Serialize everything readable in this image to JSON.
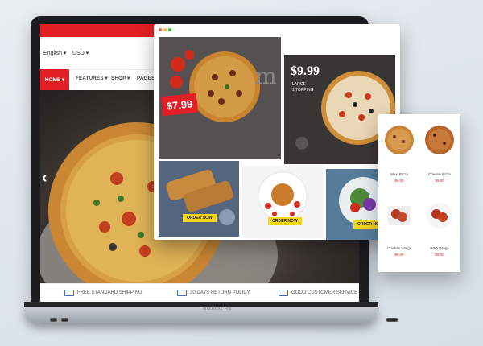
{
  "laptop": {
    "brand_label": "MacBook Pro",
    "top": {
      "language": "English",
      "currency": "USD"
    },
    "nav": {
      "home": "HOME",
      "features": "FEATURES",
      "shop": "SHOP",
      "pages": "PAGES"
    },
    "features": [
      {
        "label": "FREE STANDARD SHIPPING",
        "icon": "truck-icon"
      },
      {
        "label": "30 DAYS RETURN POLICY",
        "icon": "card-icon"
      },
      {
        "label": "GOOD CUSTOMER SERVICE",
        "icon": "thumbs-up-icon"
      }
    ]
  },
  "browser": {
    "promo1": {
      "price": "$7.99"
    },
    "promo2": {
      "price": "$9.99",
      "subtitle": "LARGE\n1 TOPPING"
    },
    "buttons": {
      "order1": "ORDER NOW",
      "order2": "ORDER NOW",
      "order3": "ORDER NOW"
    }
  },
  "side_products": [
    {
      "name": "Mexi Pizza",
      "price": "$9.00"
    },
    {
      "name": "Cheese Pizza",
      "price": "$9.00"
    },
    {
      "name": "Chicken Wings",
      "price": "$9.00"
    },
    {
      "name": "BBQ Wings",
      "price": "$9.00"
    }
  ],
  "colors": {
    "brand_red": "#e31e24",
    "button_yellow": "#f4d61b"
  }
}
